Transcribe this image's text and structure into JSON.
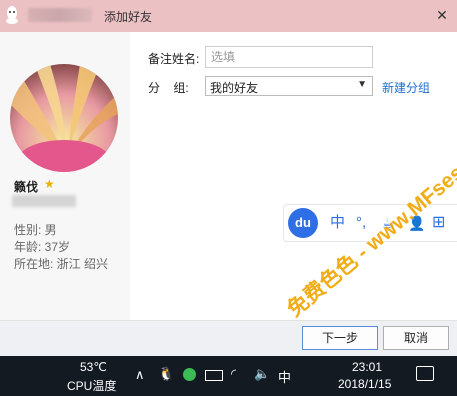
{
  "window": {
    "title": "添加好友",
    "close_label": "✕"
  },
  "profile": {
    "nickname": "籁伐",
    "gender": "性别: 男",
    "age": "年龄: 37岁",
    "location": "所在地: 浙江  绍兴"
  },
  "form": {
    "remark_label": "备注姓名:",
    "remark_placeholder": "选填",
    "group_label": "分    组:",
    "group_value": "我的好友",
    "new_group_link": "新建分组"
  },
  "ime_toolbar": {
    "logo": "du",
    "chinese": "中",
    "punct": "°,",
    "cup": "☕",
    "user": "👤",
    "grid": "⊞"
  },
  "buttons": {
    "next": "下一步",
    "cancel": "取消"
  },
  "taskbar": {
    "temp": "53℃",
    "temp_label": "CPU温度",
    "input_lang": "中",
    "time": "23:01",
    "date": "2018/1/15"
  },
  "watermark": "免费色色 - www.MFsese.com"
}
